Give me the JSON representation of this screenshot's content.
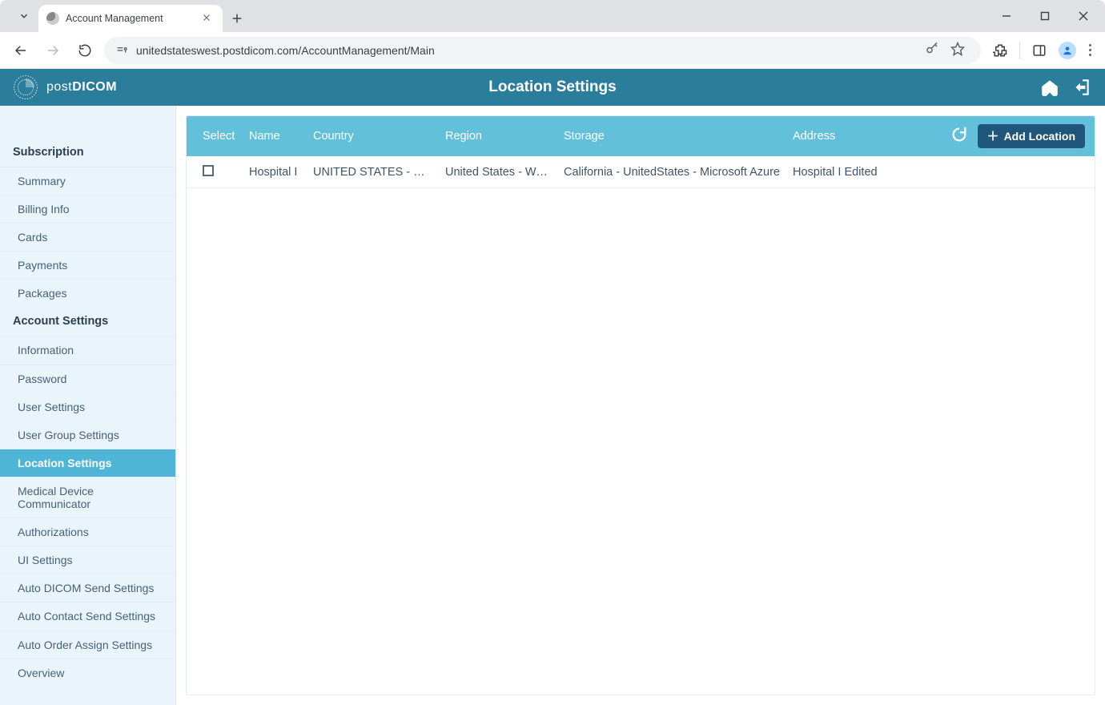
{
  "browser": {
    "tab_title": "Account Management",
    "url": "unitedstateswest.postdicom.com/AccountManagement/Main"
  },
  "header": {
    "brand_prefix": "post",
    "brand_suffix": "DICOM",
    "page_title": "Location Settings"
  },
  "sidebar": {
    "sections": [
      {
        "title": "Subscription",
        "items": [
          {
            "label": "Summary",
            "active": false
          },
          {
            "label": "Billing Info",
            "active": false
          },
          {
            "label": "Cards",
            "active": false
          },
          {
            "label": "Payments",
            "active": false
          },
          {
            "label": "Packages",
            "active": false
          }
        ]
      },
      {
        "title": "Account Settings",
        "items": [
          {
            "label": "Information",
            "active": false
          },
          {
            "label": "Password",
            "active": false
          },
          {
            "label": "User Settings",
            "active": false
          },
          {
            "label": "User Group Settings",
            "active": false
          },
          {
            "label": "Location Settings",
            "active": true
          },
          {
            "label": "Medical Device Communicator",
            "active": false
          },
          {
            "label": "Authorizations",
            "active": false
          },
          {
            "label": "UI Settings",
            "active": false
          },
          {
            "label": "Auto DICOM Send Settings",
            "active": false
          },
          {
            "label": "Auto Contact Send Settings",
            "active": false
          },
          {
            "label": "Auto Order Assign Settings",
            "active": false
          },
          {
            "label": "Overview",
            "active": false
          }
        ]
      }
    ]
  },
  "table": {
    "headers": {
      "select": "Select",
      "name": "Name",
      "country": "Country",
      "region": "Region",
      "storage": "Storage",
      "address": "Address"
    },
    "add_button": "Add Location",
    "rows": [
      {
        "name": "Hospital I",
        "country": "UNITED STATES - WEST",
        "region": "United States - West",
        "storage": "California - UnitedStates - Microsoft Azure",
        "address": "Hospital I Edited"
      }
    ]
  }
}
